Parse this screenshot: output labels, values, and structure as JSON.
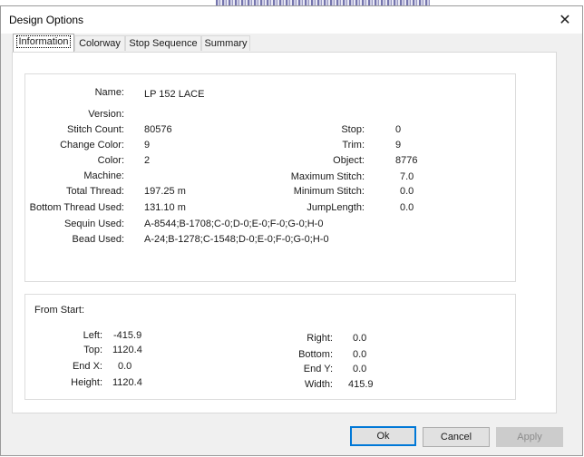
{
  "window": {
    "title": "Design Options",
    "close_glyph": "✕"
  },
  "tabs": [
    "Information",
    "Colorway",
    "Stop Sequence",
    "Summary"
  ],
  "info": {
    "name_label": "Name:",
    "name_value": "LP 152 LACE",
    "version_label": "Version:",
    "version_value": "",
    "stitch_count_label": "Stitch Count:",
    "stitch_count_value": "80576",
    "change_color_label": "Change Color:",
    "change_color_value": "9",
    "color_label": "Color:",
    "color_value": "2",
    "machine_label": "Machine:",
    "machine_value": "",
    "total_thread_label": "Total Thread:",
    "total_thread_value": "197.25 m",
    "bottom_thread_label": "Bottom Thread Used:",
    "bottom_thread_value": "131.10 m",
    "sequin_label": "Sequin Used:",
    "sequin_value": "A-8544;B-1708;C-0;D-0;E-0;F-0;G-0;H-0",
    "bead_label": "Bead Used:",
    "bead_value": "A-24;B-1278;C-1548;D-0;E-0;F-0;G-0;H-0",
    "stop_label": "Stop:",
    "stop_value": "0",
    "trim_label": "Trim:",
    "trim_value": "9",
    "object_label": "Object:",
    "object_value": "8776",
    "max_stitch_label": "Maximum Stitch:",
    "max_stitch_value": "7.0",
    "min_stitch_label": "Minimum Stitch:",
    "min_stitch_value": "0.0",
    "jump_length_label": "JumpLength:",
    "jump_length_value": "0.0"
  },
  "from_start": {
    "heading": "From Start:",
    "left_label": "Left:",
    "left_value": "-415.9",
    "top_label": "Top:",
    "top_value": "1120.4",
    "endx_label": "End X:",
    "endx_value": "0.0",
    "height_label": "Height:",
    "height_value": "1120.4",
    "right_label": "Right:",
    "right_value": "0.0",
    "bottom_label": "Bottom:",
    "bottom_value": "0.0",
    "endy_label": "End Y:",
    "endy_value": "0.0",
    "width_label": "Width:",
    "width_value": "415.9"
  },
  "buttons": {
    "ok": "Ok",
    "cancel": "Cancel",
    "apply": "Apply"
  }
}
